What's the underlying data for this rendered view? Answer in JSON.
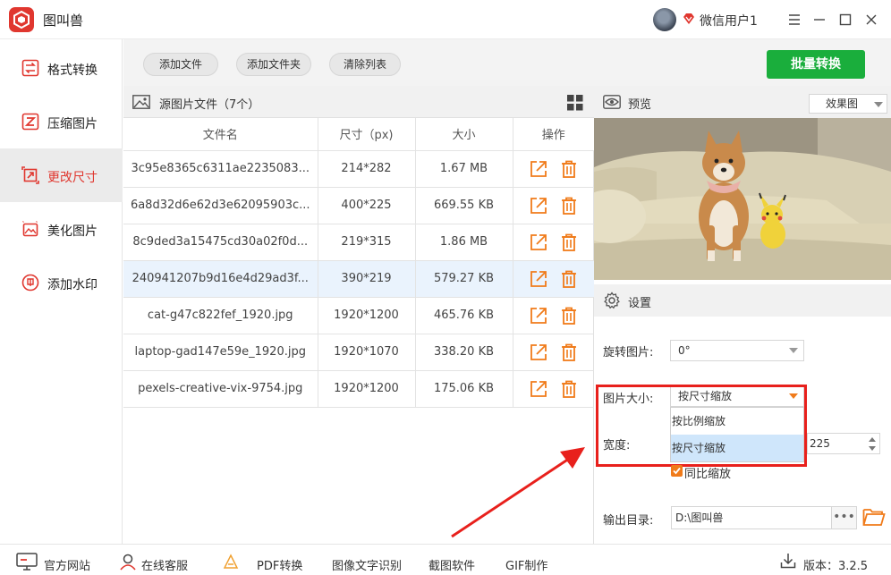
{
  "titlebar": {
    "app_name": "图叫兽",
    "username": "微信用户1",
    "icons": [
      "logo-icon",
      "avatar",
      "vip-diamond-icon",
      "menu-icon",
      "minimize-icon",
      "maximize-icon",
      "close-icon"
    ]
  },
  "sidebar": {
    "items": [
      {
        "label": "格式转换",
        "icon": "format-convert-icon"
      },
      {
        "label": "压缩图片",
        "icon": "compress-icon"
      },
      {
        "label": "更改尺寸",
        "icon": "resize-icon",
        "active": true
      },
      {
        "label": "美化图片",
        "icon": "beautify-icon"
      },
      {
        "label": "添加水印",
        "icon": "watermark-icon"
      }
    ]
  },
  "toolbar": {
    "add_file": "添加文件",
    "add_folder": "添加文件夹",
    "clear_list": "清除列表",
    "batch_convert": "批量转换"
  },
  "files": {
    "title": "源图片文件（7个）",
    "columns": [
      "文件名",
      "尺寸（px)",
      "大小",
      "操作"
    ],
    "rows": [
      {
        "name": "3c95e8365c6311ae2235083...",
        "size_px": "214*282",
        "size": "1.67 MB"
      },
      {
        "name": "6a8d32d6e62d3e62095903c...",
        "size_px": "400*225",
        "size": "669.55 KB"
      },
      {
        "name": "8c9ded3a15475cd30a02f0d...",
        "size_px": "219*315",
        "size": "1.86 MB"
      },
      {
        "name": "240941207b9d16e4d29ad3f...",
        "size_px": "390*219",
        "size": "579.27 KB",
        "selected": true
      },
      {
        "name": "cat-g47c822fef_1920.jpg",
        "size_px": "1920*1200",
        "size": "465.76 KB"
      },
      {
        "name": "laptop-gad147e59e_1920.jpg",
        "size_px": "1920*1070",
        "size": "338.20 KB"
      },
      {
        "name": "pexels-creative-vix-9754.jpg",
        "size_px": "1920*1200",
        "size": "175.06 KB"
      }
    ],
    "row_actions": [
      "open-icon",
      "delete-icon"
    ]
  },
  "preview": {
    "title": "预览",
    "mode": "效果图"
  },
  "settings": {
    "title": "设置",
    "rotate_label": "旋转图片:",
    "rotate_value": "0°",
    "size_label": "图片大小:",
    "size_value": "按尺寸缩放",
    "size_options": [
      "按比例缩放",
      "按尺寸缩放"
    ],
    "width_label": "宽度:",
    "width_value": "225",
    "keep_ratio_label": "同比缩放",
    "keep_ratio_checked": true,
    "output_label": "输出目录:",
    "output_value": "D:\\图叫兽",
    "browse_label": "•••"
  },
  "footer": {
    "items": [
      "官方网站",
      "在线客服",
      "PDF转换",
      "图像文字识别",
      "截图软件",
      "GIF制作"
    ],
    "version": "版本：3.2.5"
  },
  "colors": {
    "brand_red": "#e0372f",
    "green": "#1aae3c",
    "orange": "#f07b1a",
    "highlight_red": "#e8201c"
  }
}
